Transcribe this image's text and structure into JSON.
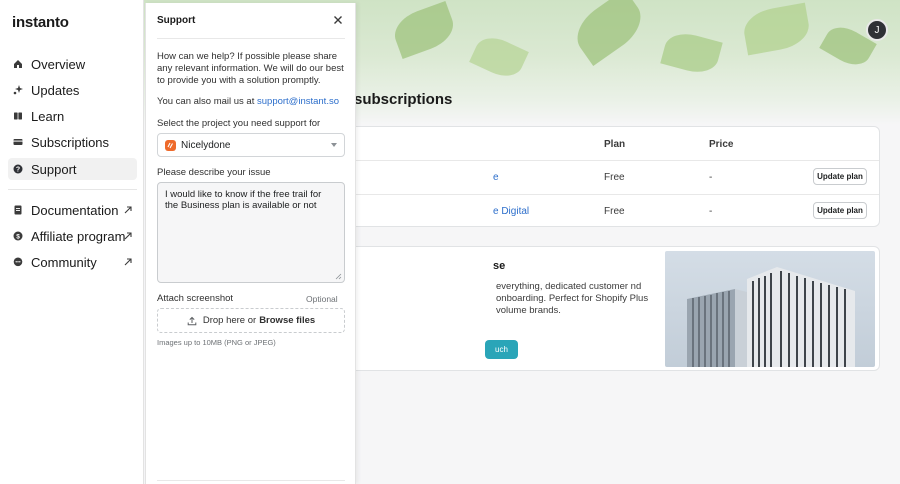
{
  "sidebar": {
    "logo": "instanto",
    "items": [
      {
        "label": "Overview",
        "icon": "home-icon"
      },
      {
        "label": "Updates",
        "icon": "sparkle-icon"
      },
      {
        "label": "Learn",
        "icon": "book-icon"
      },
      {
        "label": "Subscriptions",
        "icon": "card-icon"
      },
      {
        "label": "Support",
        "icon": "help-icon",
        "active": true
      }
    ],
    "external_items": [
      {
        "label": "Documentation",
        "icon": "document-icon"
      },
      {
        "label": "Affiliate program",
        "icon": "dollar-icon"
      },
      {
        "label": "Community",
        "icon": "chat-icon"
      }
    ]
  },
  "header": {
    "avatar_initial": "J",
    "page_title": "subscriptions"
  },
  "table": {
    "headers": [
      "Plan",
      "Price"
    ],
    "rows": [
      {
        "name": "e",
        "plan": "Free",
        "price": "-",
        "action": "Update plan"
      },
      {
        "name": "e Digital",
        "plan": "Free",
        "price": "-",
        "action": "Update plan"
      }
    ]
  },
  "promo": {
    "title": "se",
    "text": "everything, dedicated customer nd onboarding. Perfect for Shopify Plus volume brands.",
    "button": "uch"
  },
  "support_panel": {
    "title": "Support",
    "intro": "How can we help? If possible please share any relevant information. We will do our best to provide you with a solution promptly.",
    "mail_prefix": "You can also mail us at ",
    "mail_link": "support@instant.so",
    "project_label": "Select the project you need support for",
    "project_value": "Nicelydone",
    "issue_label": "Please describe your issue",
    "issue_value": "I would like to know if the free trail for the Business plan is available or not",
    "attach_label": "Attach screenshot",
    "attach_optional": "Optional",
    "drop_text": "Drop here or",
    "browse_text": "Browse files",
    "file_hint": "Images up to 10MB (PNG or JPEG)"
  },
  "colors": {
    "accent": "#2c6ecb",
    "project_icon": "#ee6a2b",
    "promo_button": "#2aa5b8"
  }
}
